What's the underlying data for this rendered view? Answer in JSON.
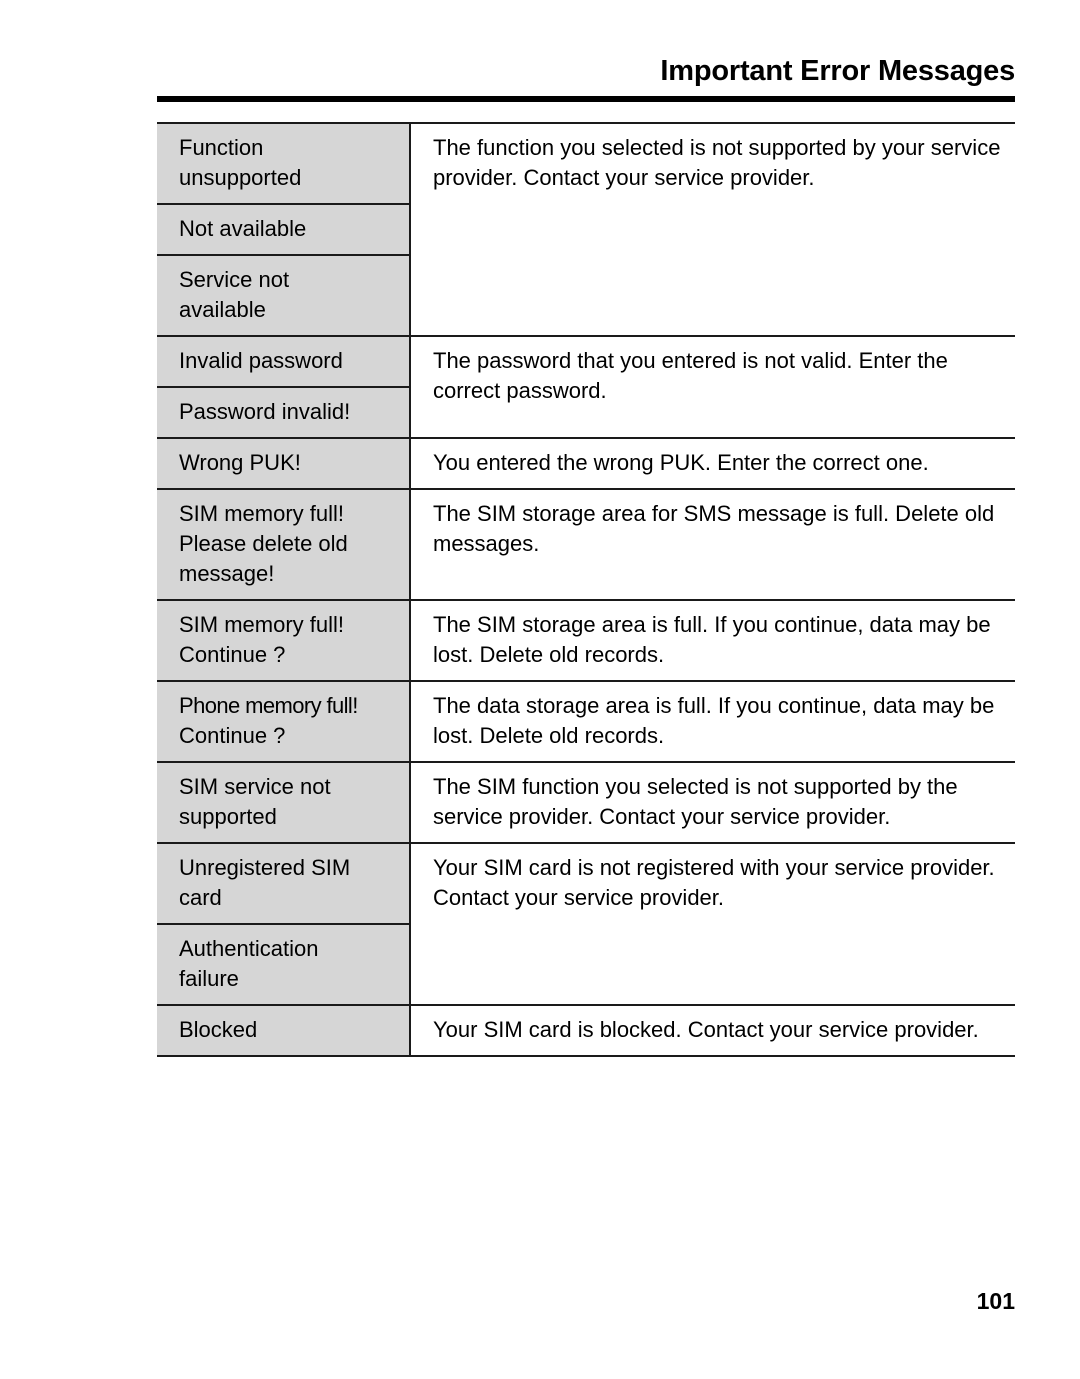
{
  "header": {
    "title": "Important Error Messages"
  },
  "folio": {
    "page_number": "101"
  },
  "colors": {
    "message_cell_background": "#d6d6d6",
    "rule": "#1a1a1a",
    "page_background": "#ffffff",
    "text": "#000000"
  },
  "table": {
    "groups": [
      {
        "messages": [
          [
            "Function",
            "unsupported"
          ],
          [
            "Not available"
          ],
          [
            "Service not",
            "available"
          ]
        ],
        "description": "The function you selected is not supported by your service provider. Contact your service provider."
      },
      {
        "messages": [
          [
            "Invalid password"
          ],
          [
            "Password invalid!"
          ]
        ],
        "description": "The password that you entered is not valid. Enter the correct password."
      },
      {
        "messages": [
          [
            "Wrong PUK!"
          ]
        ],
        "description": "You entered the wrong PUK. Enter the correct one."
      },
      {
        "messages": [
          [
            "SIM memory full!",
            "Please delete old",
            "message!"
          ]
        ],
        "description": "The SIM storage area for SMS message is full. Delete old messages."
      },
      {
        "messages": [
          [
            "SIM memory full!",
            "Continue ?"
          ]
        ],
        "description": "The SIM storage area is full. If you continue, data may be lost. Delete old records."
      },
      {
        "messages": [
          [
            "Phone memory full!",
            "Continue ?"
          ]
        ],
        "description": "The data storage area is full. If you continue, data may be lost. Delete old records."
      },
      {
        "messages": [
          [
            "SIM service not",
            "supported"
          ]
        ],
        "description": "The SIM function you selected is not supported by the service provider. Contact your service provider."
      },
      {
        "messages": [
          [
            "Unregistered SIM",
            "card"
          ],
          [
            "Authentication",
            "failure"
          ]
        ],
        "description": "Your SIM card is not registered with your service provider. Contact your service provider."
      },
      {
        "messages": [
          [
            "Blocked"
          ]
        ],
        "description": "Your SIM card is blocked. Contact your service provider."
      }
    ]
  }
}
